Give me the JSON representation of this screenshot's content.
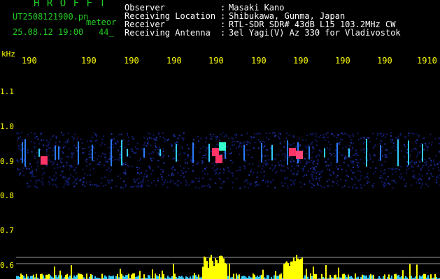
{
  "header": {
    "title": "H R O F F T",
    "filename": "UT2508121900.pn",
    "meteor_label": "meteor",
    "datetime": "25.08.12 19:00",
    "count": "44_"
  },
  "info": {
    "observer_label": "Observer",
    "observer_value": "Masaki Kano",
    "location_label": "Receiving Location",
    "location_value": "Shibukawa, Gunma, Japan",
    "receiver_label": "Receiver",
    "receiver_value": "RTL-SDR SDR# 43dB L15 103.2MHz CW",
    "antenna_label": "Receiving Antenna",
    "antenna_value": "3el Yagi(V) Az 330 for Vladivostok",
    "colon": ":"
  },
  "axis": {
    "khz_label": "kHz",
    "time_ticks": [
      "190",
      "190",
      "190",
      "190",
      "190",
      "190",
      "190",
      "190",
      "190",
      "1910"
    ],
    "freq_ticks": [
      "1.1",
      "1.0",
      "0.9",
      "0.8",
      "0.7",
      "0.6"
    ]
  },
  "colors": {
    "background": "#000000",
    "title_green": "#22cc22",
    "text_white": "#ffffff",
    "tick_yellow": "#ffff00",
    "echo_red": "#ff3366",
    "echo_cyan": "#33ccff"
  }
}
